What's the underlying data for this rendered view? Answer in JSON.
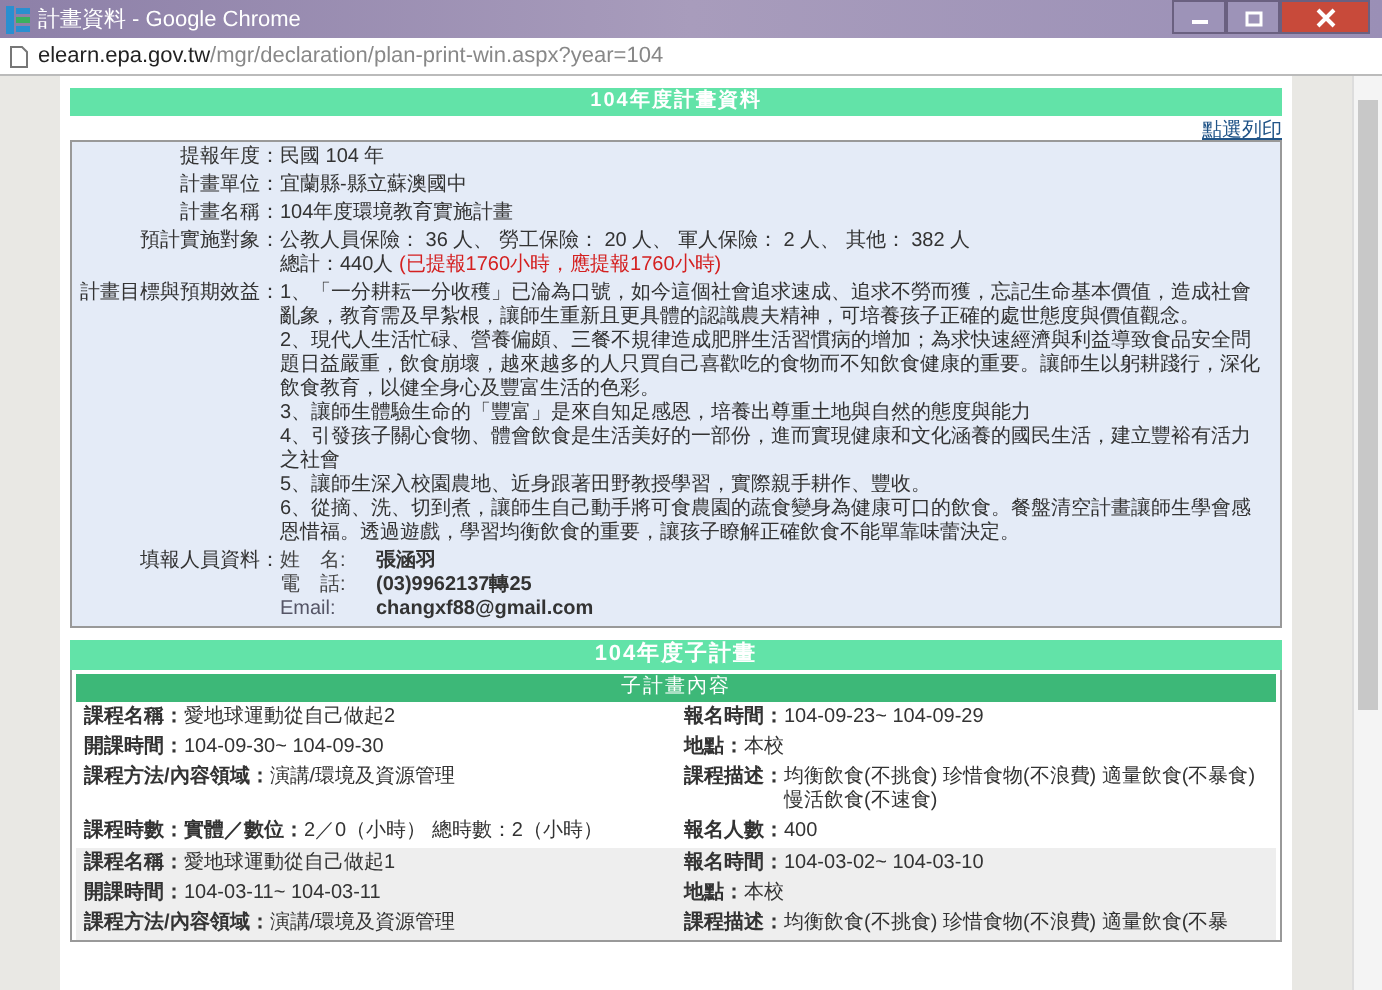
{
  "window": {
    "title": "計畫資料 - Google Chrome",
    "url_host": "elearn.epa.gov.tw",
    "url_path": "/mgr/declaration/plan-print-win.aspx?year=104"
  },
  "plan": {
    "title": "104年度計畫資料",
    "print_link": "點選列印",
    "rows": [
      {
        "kind": "text",
        "label": "提報年度：",
        "value": "民國 104 年"
      },
      {
        "kind": "text",
        "label": "計畫單位：",
        "value": "宜蘭縣-縣立蘇澳國中"
      },
      {
        "kind": "text",
        "label": "計畫名稱：",
        "value": "104年度環境教育實施計畫"
      },
      {
        "kind": "targets",
        "label": "預計實施對象：",
        "value": "公教人員保險： 36 人、 勞工保險： 20 人、 軍人保險： 2 人、 其他： 382 人",
        "total": "總計：440人",
        "hours_note": "(已提報1760小時，應提報1760小時)"
      },
      {
        "kind": "goals",
        "label": "計畫目標與預期效益：",
        "items": [
          "1、「一分耕耘一分收穫」已淪為口號，如今這個社會追求速成、追求不勞而獲，忘記生命基本價值，造成社會亂象，教育需及早紮根，讓師生重新且更具體的認識農夫精神，可培養孩子正確的處世態度與價值觀念。",
          "2、現代人生活忙碌、營養偏頗、三餐不規律造成肥胖生活習慣病的增加；為求快速經濟與利益導致食品安全問題日益嚴重，飲食崩壞，越來越多的人只買自己喜歡吃的食物而不知飲食健康的重要。讓師生以躬耕踐行，深化飲食教育，以健全身心及豐富生活的色彩。",
          "3、讓師生體驗生命的「豐富」是來自知足感恩，培養出尊重土地與自然的態度與能力",
          "4、引發孩子關心食物、體會飲食是生活美好的一部份，進而實現健康和文化涵養的國民生活，建立豐裕有活力之社會",
          "5、讓師生深入校園農地、近身跟著田野教授學習，實際親手耕作、豐收。",
          "6、從摘、洗、切到煮，讓師生自己動手將可食農園的蔬食變身為健康可口的飲食。餐盤清空計畫讓師生學會感恩惜福。透過遊戲，學習均衡飲食的重要，讓孩子瞭解正確飲食不能單靠味蕾決定。"
        ]
      },
      {
        "kind": "contact",
        "label": "填報人員資料：",
        "entries": [
          {
            "label": "姓　名:",
            "value": "張涵羽"
          },
          {
            "label": "電　話:",
            "value": "(03)9962137轉25"
          },
          {
            "label": "Email:",
            "value": "changxf88@gmail.com"
          }
        ]
      }
    ]
  },
  "subplans": {
    "title": "104年度子計畫",
    "header": "子計畫內容",
    "courses": [
      {
        "fields": [
          {
            "label": "課程名稱：",
            "value": "愛地球運動從自己做起2"
          },
          {
            "label": "報名時間：",
            "value": "104-09-23~ 104-09-29"
          },
          {
            "label": "開課時間：",
            "value": "104-09-30~ 104-09-30"
          },
          {
            "label": "地點：",
            "value": "本校"
          },
          {
            "label": "課程方法/內容領域：",
            "value": "演講/環境及資源管理"
          },
          {
            "label": "課程描述：",
            "value": "均衡飲食(不挑食) 珍惜食物(不浪費) 適量飲食(不暴食) 慢活飲食(不速食)"
          },
          {
            "label": "課程時數：實體／數位：",
            "value": "2／0（小時） 總時數：2（小時）"
          },
          {
            "label": "報名人數：",
            "value": "400"
          }
        ]
      },
      {
        "fields": [
          {
            "label": "課程名稱：",
            "value": "愛地球運動從自己做起1"
          },
          {
            "label": "報名時間：",
            "value": "104-03-02~ 104-03-10"
          },
          {
            "label": "開課時間：",
            "value": "104-03-11~ 104-03-11"
          },
          {
            "label": "地點：",
            "value": "本校"
          },
          {
            "label": "課程方法/內容領域：",
            "value": "演講/環境及資源管理"
          },
          {
            "label": "課程描述：",
            "value": "均衡飲食(不挑食) 珍惜食物(不浪費) 適量飲食(不暴"
          }
        ]
      }
    ]
  }
}
